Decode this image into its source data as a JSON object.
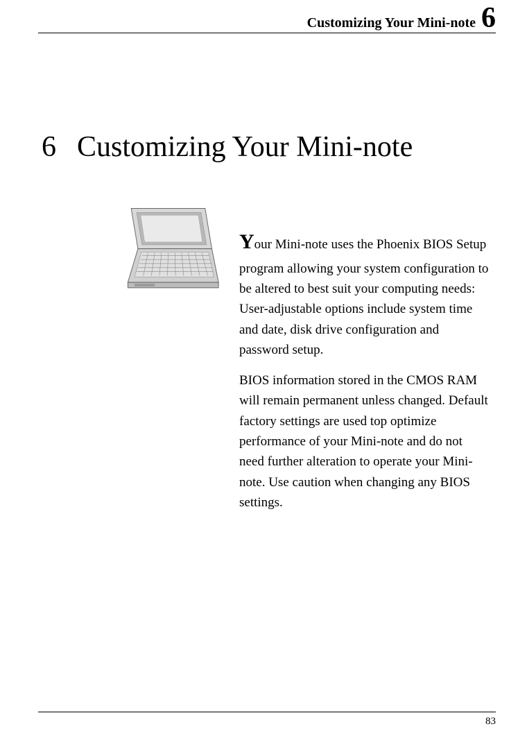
{
  "header": {
    "title": "Customizing Your Mini-note",
    "chapter_number_top": "6"
  },
  "chapter": {
    "number": "6",
    "title": "Customizing Your Mini-note"
  },
  "body": {
    "para1_dropcap": "Y",
    "para1_rest": "our Mini-note uses the Phoenix BIOS Setup program allowing your system configuration to be altered to best suit your computing needs: User-adjustable options include system time and date, disk drive configuration and password setup.",
    "para2": "BIOS information stored in the CMOS RAM will remain permanent unless changed. Default factory settings are used top optimize performance of your Mini-note and do not need further alteration to operate your Mini-note. Use caution when changing any BIOS settings."
  },
  "footer": {
    "page_number": "83"
  }
}
